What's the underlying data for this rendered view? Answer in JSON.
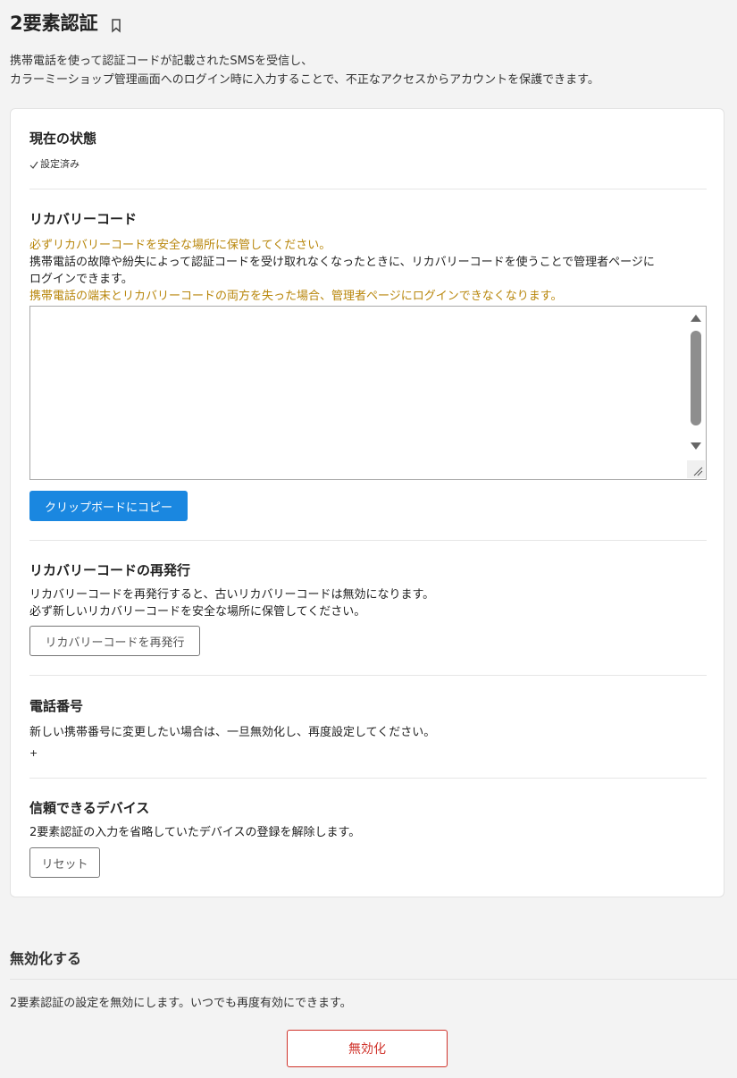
{
  "page": {
    "title": "2要素認証",
    "intro_line1": "携帯電話を使って認証コードが記載されたSMSを受信し、",
    "intro_line2": "カラーミーショップ管理画面へのログイン時に入力することで、不正なアクセスからアカウントを保護できます。"
  },
  "status": {
    "heading": "現在の状態",
    "value": "設定済み"
  },
  "recovery": {
    "heading": "リカバリーコード",
    "warning1": "必ずリカバリーコードを安全な場所に保管してください。",
    "desc_line1": "携帯電話の故障や紛失によって認証コードを受け取れなくなったときに、リカバリーコードを使うことで管理者ページに",
    "desc_line2": "ログインできます。",
    "warning2": "携帯電話の端末とリカバリーコードの両方を失った場合、管理者ページにログインできなくなります。",
    "codes_value": "",
    "copy_button": "クリップボードにコピー"
  },
  "reissue": {
    "heading": "リカバリーコードの再発行",
    "desc_line1": "リカバリーコードを再発行すると、古いリカバリーコードは無効になります。",
    "desc_line2": "必ず新しいリカバリーコードを安全な場所に保管してください。",
    "button": "リカバリーコードを再発行"
  },
  "phone": {
    "heading": "電話番号",
    "desc": "新しい携帯番号に変更したい場合は、一旦無効化し、再度設定してください。",
    "number": "+"
  },
  "devices": {
    "heading": "信頼できるデバイス",
    "desc": "2要素認証の入力を省略していたデバイスの登録を解除します。",
    "button": "リセット"
  },
  "disable": {
    "heading": "無効化する",
    "desc": "2要素認証の設定を無効にします。いつでも再度有効にできます。",
    "button": "無効化"
  },
  "colors": {
    "primary": "#1a87e0",
    "warning": "#b8860b",
    "danger": "#d0332b"
  }
}
